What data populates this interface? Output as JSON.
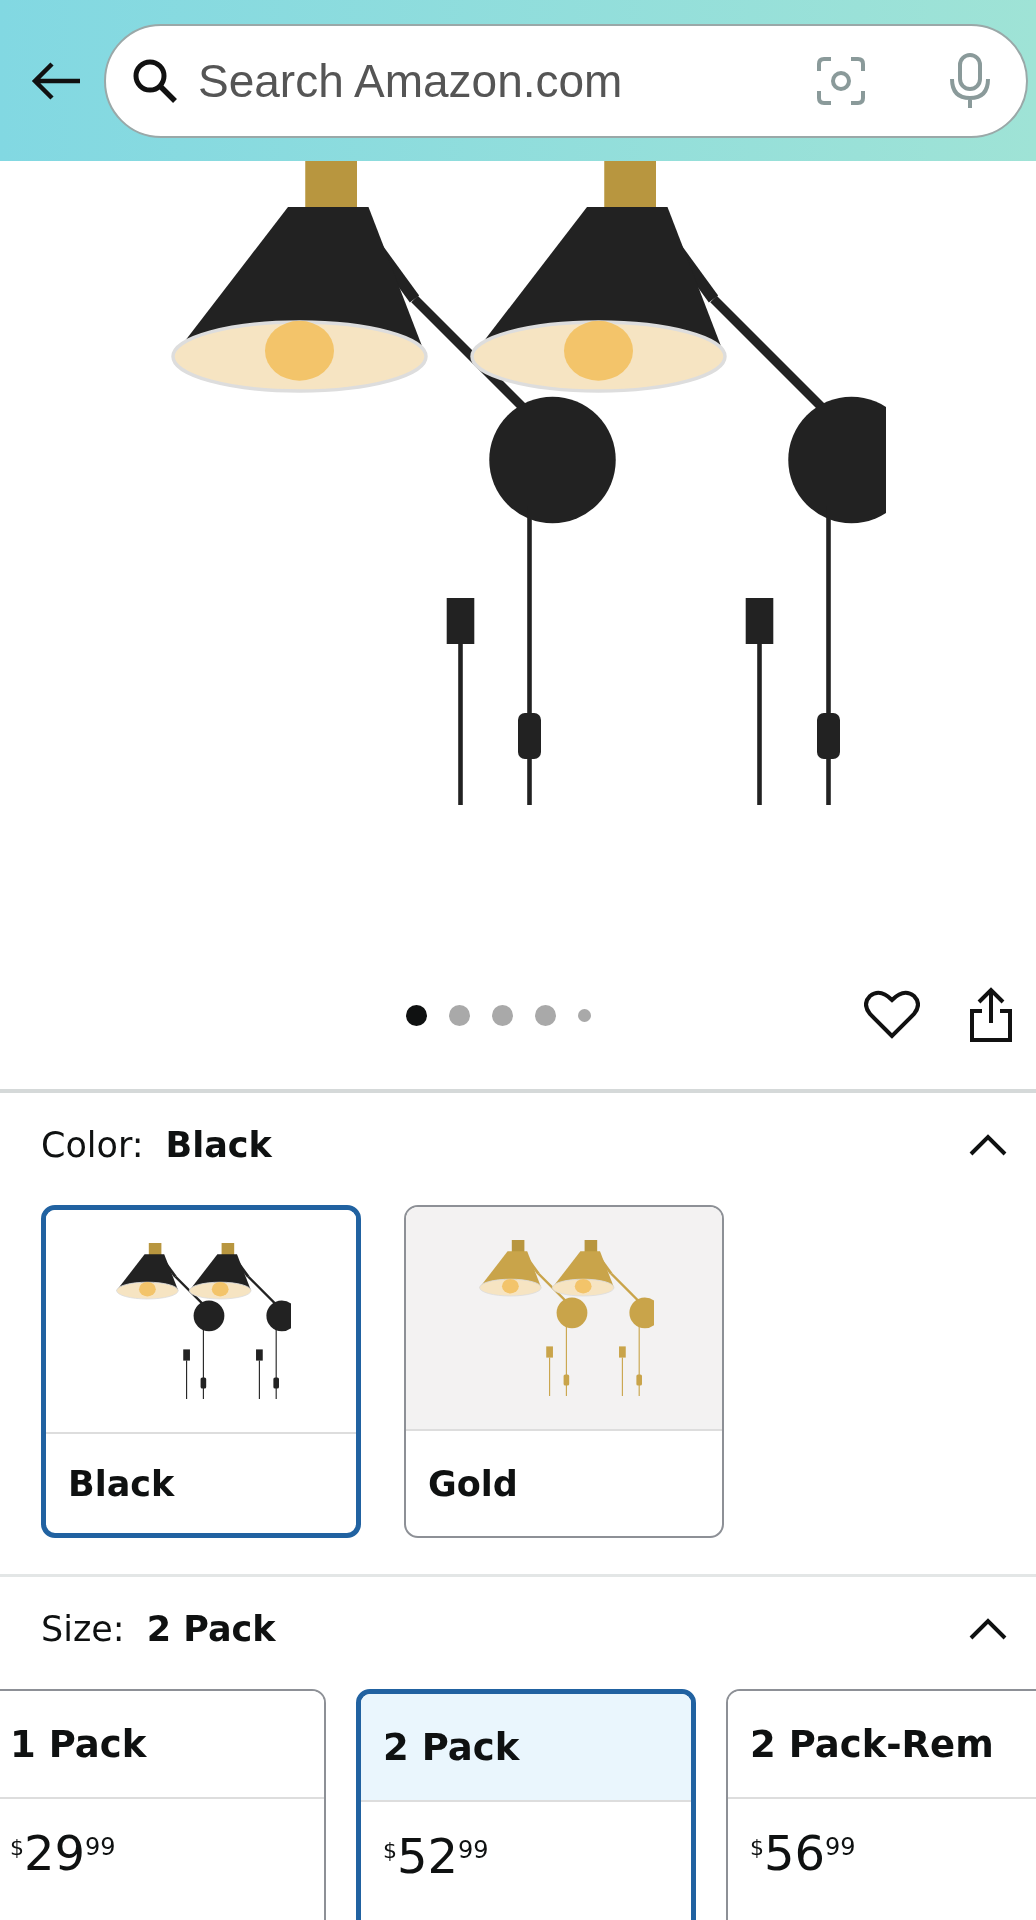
{
  "search": {
    "placeholder": "Search Amazon.com"
  },
  "gallery": {
    "dots": [
      {
        "selected": true,
        "small": false
      },
      {
        "selected": false,
        "small": false
      },
      {
        "selected": false,
        "small": false
      },
      {
        "selected": false,
        "small": false
      },
      {
        "selected": false,
        "small": true
      }
    ]
  },
  "color": {
    "label": "Color:",
    "value": "Black",
    "expanded": true,
    "swatches": [
      {
        "label": "Black",
        "color": "#222222",
        "selected": true
      },
      {
        "label": "Gold",
        "color": "#c9a44a",
        "selected": false
      }
    ]
  },
  "size": {
    "label": "Size:",
    "value": "2 Pack",
    "expanded": true,
    "options": [
      {
        "label": "1 Pack",
        "currency": "$",
        "whole": "29",
        "fraction": "99",
        "selected": false
      },
      {
        "label": "2 Pack",
        "currency": "$",
        "whole": "52",
        "fraction": "99",
        "selected": true
      },
      {
        "label": "2 Pack-Rem",
        "currency": "$",
        "whole": "56",
        "fraction": "99",
        "selected": false
      }
    ]
  }
}
